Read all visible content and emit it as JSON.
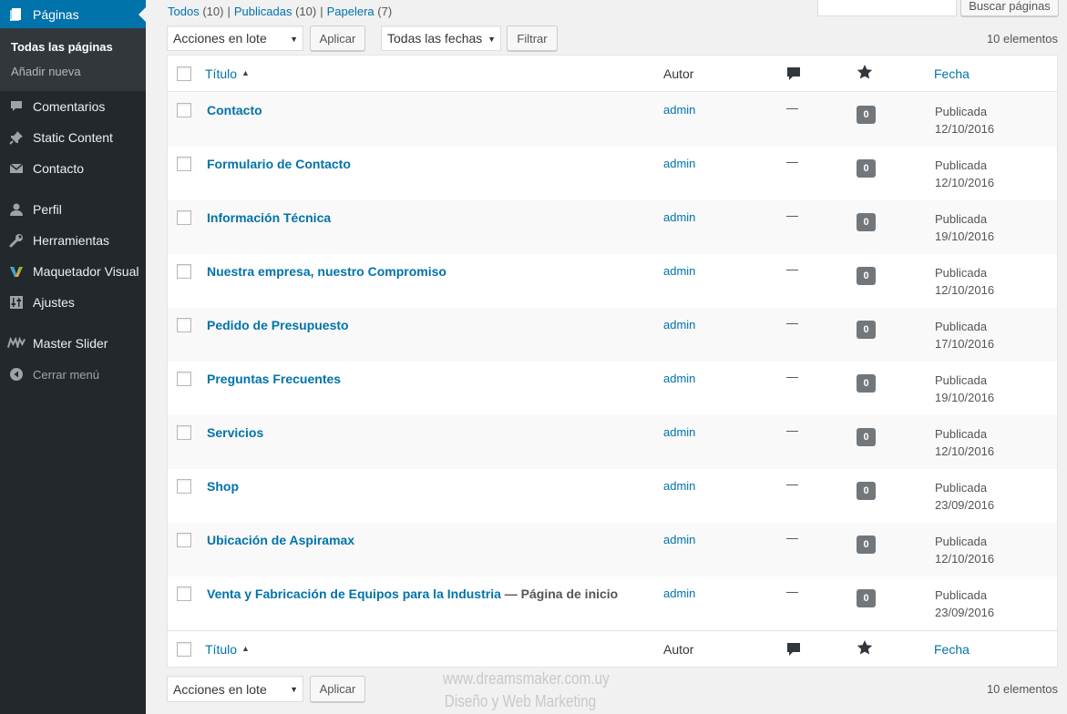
{
  "sidebar": {
    "current": {
      "label": "Páginas",
      "icon": "pages-icon"
    },
    "submenu": [
      {
        "label": "Todas las páginas",
        "active": true
      },
      {
        "label": "Añadir nueva",
        "active": false
      }
    ],
    "items": [
      {
        "label": "Comentarios",
        "icon": "comment-icon"
      },
      {
        "label": "Static Content",
        "icon": "pin-icon"
      },
      {
        "label": "Contacto",
        "icon": "mail-icon"
      },
      {
        "label": "Perfil",
        "icon": "user-icon"
      },
      {
        "label": "Herramientas",
        "icon": "wrench-icon"
      },
      {
        "label": "Maquetador Visual",
        "icon": "visual-builder-icon"
      },
      {
        "label": "Ajustes",
        "icon": "settings-icon"
      },
      {
        "label": "Master Slider",
        "icon": "master-slider-icon"
      },
      {
        "label": "Cerrar menú",
        "icon": "collapse-icon"
      }
    ]
  },
  "views": {
    "all": {
      "label": "Todos",
      "count": "(10)"
    },
    "published": {
      "label": "Publicadas",
      "count": "(10)"
    },
    "trash": {
      "label": "Papelera",
      "count": "(7)"
    },
    "separator": "|"
  },
  "search": {
    "value": "",
    "button": "Buscar páginas"
  },
  "top_nav": {
    "bulk_actions": "Acciones en lote",
    "apply": "Aplicar",
    "date_filter": "Todas las fechas",
    "filter": "Filtrar",
    "count": "10 elementos"
  },
  "bottom_nav": {
    "bulk_actions": "Acciones en lote",
    "apply": "Aplicar",
    "count": "10 elementos"
  },
  "columns": {
    "title": "Título",
    "author": "Autor",
    "comments_icon": "comment-icon",
    "rating_icon": "star-icon",
    "date": "Fecha"
  },
  "rows": [
    {
      "title": "Contacto",
      "state": "",
      "author": "admin",
      "dash": "—",
      "count": "0",
      "status": "Publicada",
      "date": "12/10/2016"
    },
    {
      "title": "Formulario de Contacto",
      "state": "",
      "author": "admin",
      "dash": "—",
      "count": "0",
      "status": "Publicada",
      "date": "12/10/2016"
    },
    {
      "title": "Información Técnica",
      "state": "",
      "author": "admin",
      "dash": "—",
      "count": "0",
      "status": "Publicada",
      "date": "19/10/2016"
    },
    {
      "title": "Nuestra empresa, nuestro Compromiso",
      "state": "",
      "author": "admin",
      "dash": "—",
      "count": "0",
      "status": "Publicada",
      "date": "12/10/2016"
    },
    {
      "title": "Pedido de Presupuesto",
      "state": "",
      "author": "admin",
      "dash": "—",
      "count": "0",
      "status": "Publicada",
      "date": "17/10/2016"
    },
    {
      "title": "Preguntas Frecuentes",
      "state": "",
      "author": "admin",
      "dash": "—",
      "count": "0",
      "status": "Publicada",
      "date": "19/10/2016"
    },
    {
      "title": "Servicios",
      "state": "",
      "author": "admin",
      "dash": "—",
      "count": "0",
      "status": "Publicada",
      "date": "12/10/2016"
    },
    {
      "title": "Shop",
      "state": "",
      "author": "admin",
      "dash": "—",
      "count": "0",
      "status": "Publicada",
      "date": "23/09/2016"
    },
    {
      "title": "Ubicación de Aspiramax",
      "state": "",
      "author": "admin",
      "dash": "—",
      "count": "0",
      "status": "Publicada",
      "date": "12/10/2016"
    },
    {
      "title": "Venta y Fabricación de Equipos para la Industria",
      "state": " — Página de inicio",
      "author": "admin",
      "dash": "—",
      "count": "0",
      "status": "Publicada",
      "date": "23/09/2016"
    }
  ],
  "watermark": {
    "line1": "www.dreamsmaker.com.uy",
    "line2": "Diseño y Web Marketing"
  },
  "colors": {
    "sidebar": "#23282d",
    "accent": "#0073aa",
    "submenu": "#32373c"
  }
}
